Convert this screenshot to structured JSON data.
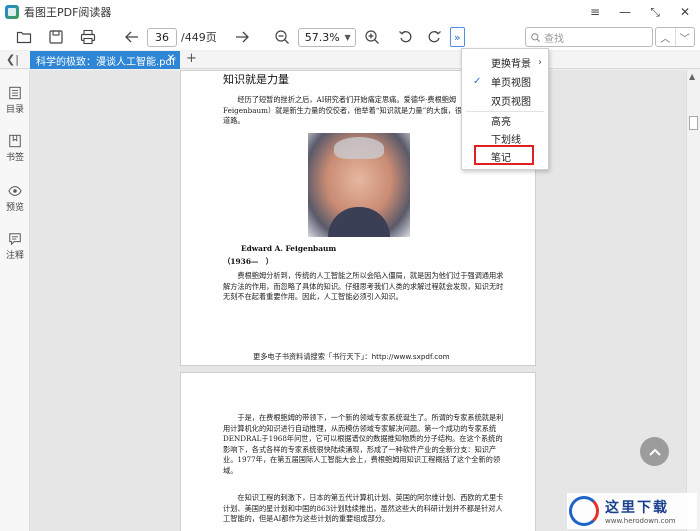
{
  "titlebar": {
    "app_name": "看图王PDF阅读器",
    "controls": [
      "≡",
      "—",
      "⤡",
      "✕"
    ]
  },
  "toolbar": {
    "page_current": "36",
    "page_total": "/449页",
    "zoom": "57.3%",
    "more": "»",
    "search_placeholder": "查找"
  },
  "tabs": [
    {
      "label": "科学的极致：漫谈人工智能.pdf",
      "close": "✕"
    }
  ],
  "tab_add": "+",
  "sidebar": {
    "items": [
      "目录",
      "书签",
      "预览",
      "注释"
    ]
  },
  "menu": {
    "items": [
      {
        "label": "更换背景",
        "has_submenu": true
      },
      {
        "label": "单页视图",
        "checked": true
      },
      {
        "label": "双页视图"
      },
      {
        "label": "高亮"
      },
      {
        "label": "下划线"
      },
      {
        "label": "笔记",
        "selected": true
      }
    ]
  },
  "document": {
    "page1": {
      "heading": "知识就是力量",
      "para1": "经历了短暂的挫折之后，AI研究者们开始痛定思痛。爱德华·费根鲍姆（Edward A. Feigenbaum）就是新生力量的佼佼者，他举着“知识就是力量”的大旗，很快开辟了新的道路。",
      "name": "Edward A. Feigenbaum",
      "years": "（1936—　）",
      "para2": "费根鲍姆分析到，传统的人工智能之所以会陷入僵局，就是因为他们过于强调通用求解方法的作用，而忽略了具体的知识。仔细思考我们人类的求解过程就会发现，知识无时无刻不在起着重要作用。因此，人工智能必须引入知识。",
      "footer": "更多电子书资料请搜索「书行天下」：http://www.sxpdf.com"
    },
    "page2": {
      "para1": "于是，在费根鲍姆的带领下，一个新的领域专家系统诞生了。所谓的专家系统就是利用计算机化的知识进行自动推理，从而模仿领域专家解决问题。第一个成功的专家系统DENDRAL于1968年问世，它可以根据谱仪的数据推知物质的分子结构。在这个系统的影响下，各式各样的专家系统很快陆续涌现，形成了一种软件产业的全新分支：知识产业。1977年，在第五届国际人工智能大会上，费根鲍姆用知识工程概括了这个全新的领域。",
      "para2": "在知识工程的刺激下，日本的第五代计算机计划、英国的阿尔维计划、西欧的尤里卡计划、美国的星计划和中国的863计划陆续推出，虽然这些大的科研计划并不都是针对人工智能的，但是AI都作为这些计划的重要组成部分。"
    }
  },
  "watermark": {
    "text": "这里下载",
    "url": "www.herodown.com"
  },
  "colors": {
    "accent": "#2f86d6",
    "menu_highlight": "#e02020"
  }
}
